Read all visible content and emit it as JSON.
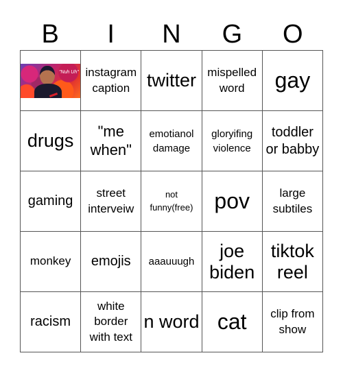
{
  "header": {
    "letters": [
      "B",
      "I",
      "N",
      "G",
      "O"
    ]
  },
  "board": {
    "rows": [
      [
        {
          "type": "image",
          "alt": "Miles Morales meme",
          "caption": "\"Nuh Uh\""
        },
        {
          "type": "text",
          "text": "instagram caption"
        },
        {
          "type": "text",
          "text": "twitter"
        },
        {
          "type": "text",
          "text": "mispelled word"
        },
        {
          "type": "text",
          "text": "gay"
        }
      ],
      [
        {
          "type": "text",
          "text": "drugs"
        },
        {
          "type": "text",
          "text": "\"me when\""
        },
        {
          "type": "text",
          "text": "emotianol damage"
        },
        {
          "type": "text",
          "text": "gloryifing violence"
        },
        {
          "type": "text",
          "text": "toddler or babby"
        }
      ],
      [
        {
          "type": "text",
          "text": "gaming"
        },
        {
          "type": "text",
          "text": "street interveiw"
        },
        {
          "type": "text",
          "text": "not funny(free)"
        },
        {
          "type": "text",
          "text": "pov"
        },
        {
          "type": "text",
          "text": "large subtiles"
        }
      ],
      [
        {
          "type": "text",
          "text": "monkey"
        },
        {
          "type": "text",
          "text": "emojis"
        },
        {
          "type": "text",
          "text": "aaauuugh"
        },
        {
          "type": "text",
          "text": "joe biden"
        },
        {
          "type": "text",
          "text": "tiktok reel"
        }
      ],
      [
        {
          "type": "text",
          "text": "racism"
        },
        {
          "type": "text",
          "text": "white border with text"
        },
        {
          "type": "text",
          "text": "n word"
        },
        {
          "type": "text",
          "text": "cat"
        },
        {
          "type": "text",
          "text": "clip from show"
        }
      ]
    ]
  }
}
